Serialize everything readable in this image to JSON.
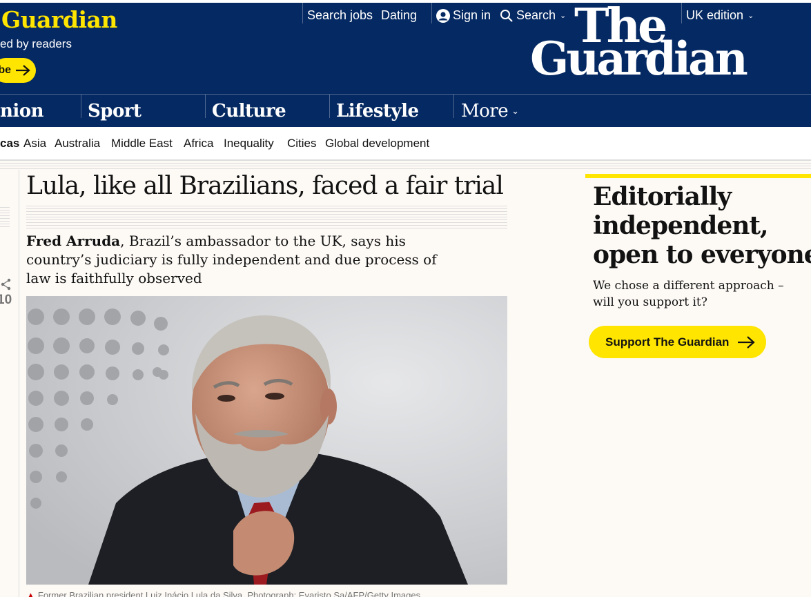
{
  "header": {
    "support_title": "Guardian",
    "support_sub": "ed by readers",
    "support_btn_label": "be",
    "links": {
      "search_jobs": "Search jobs",
      "dating": "Dating",
      "sign_in": "Sign in",
      "search": "Search",
      "edition": "UK edition"
    },
    "logo_line1": "The",
    "logo_line2": "Guardian",
    "pillars": {
      "opinion": "nion",
      "sport": "Sport",
      "culture": "Culture",
      "lifestyle": "Lifestyle",
      "more": "More"
    },
    "colors": {
      "brand": "#052962",
      "accent": "#ffe500"
    }
  },
  "subnav": {
    "items": [
      "cas",
      "Asia",
      "Australia",
      "Middle East",
      "Africa",
      "Inequality",
      "Cities",
      "Global development"
    ]
  },
  "left_rail": {
    "share_count": "10"
  },
  "article": {
    "headline": "Lula, like all Brazilians, faced a fair trial",
    "standfirst_author": "Fred Arruda",
    "standfirst_text": ", Brazil’s ambassador to the UK, says his country’s judiciary is fully independent and due process of law is faithfully observed",
    "caption": "Former Brazilian president Luiz Inácio Lula da Silva. Photograph: Evaristo Sa/AFP/Getty Images"
  },
  "support_panel": {
    "title_line1": "Editorially",
    "title_line2": "independent,",
    "title_line3": "open to everyone",
    "body": "We chose a different approach – will you support it?",
    "button_label": "Support The Guardian"
  }
}
